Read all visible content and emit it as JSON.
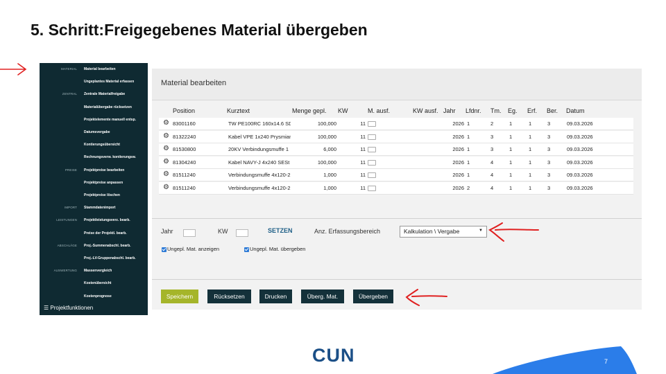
{
  "slide": {
    "title": "5. Schritt:Freigegebenes Material übergeben",
    "page_number": "7",
    "logo_text": "CUN"
  },
  "sidebar": {
    "rows": [
      {
        "category": "MATERIAL",
        "item": "Material bearbeiten"
      },
      {
        "category": "",
        "item": "Ungeplantes Material erfassen"
      },
      {
        "category": "ZENTRAL",
        "item": "Zentrale Materialfreigabe"
      },
      {
        "category": "",
        "item": "Materialübergabe rücksetzen"
      },
      {
        "category": "",
        "item": "Projektelemente manuell entsp."
      },
      {
        "category": "",
        "item": "Datumsvergabe"
      },
      {
        "category": "",
        "item": "Kontierungsübersicht"
      },
      {
        "category": "",
        "item": "Rechnungsverw. kontierungsw."
      },
      {
        "category": "PREISE",
        "item": "Projektpreise bearbeiten"
      },
      {
        "category": "",
        "item": "Projektpreise anpassen"
      },
      {
        "category": "",
        "item": "Projektpreise löschen"
      },
      {
        "category": "IMPORT",
        "item": "Stammdatenimport"
      },
      {
        "category": "LEISTUNGEN",
        "item": "Projektleistungsverz. bearb."
      },
      {
        "category": "",
        "item": "Preise der Projektl. bearb."
      },
      {
        "category": "ABSCHLÄGE",
        "item": "Proj.-Summenabschl. bearb."
      },
      {
        "category": "",
        "item": "Proj.-LV-Gruppenabschl. bearb."
      },
      {
        "category": "AUSWERTUNG",
        "item": "Massenvergleich"
      },
      {
        "category": "",
        "item": "Kostenübersicht"
      },
      {
        "category": "",
        "item": "Kostenprognose"
      }
    ],
    "footer_icon": "menu-icon",
    "footer_label": "Projektfunktionen"
  },
  "main": {
    "title": "Material bearbeiten",
    "columns": [
      "Position",
      "Kurztext",
      "Menge gepl.",
      "KW",
      "M. ausf.",
      "KW ausf.",
      "Jahr",
      "Lfdnr.",
      "Tm.",
      "Eg.",
      "Erf.",
      "Ber.",
      "Datum"
    ],
    "rows": [
      {
        "position": "83001160",
        "kurztext": "TW PE100RC 160x14.6 SD",
        "menge": "100,000",
        "kw": "11",
        "jahr": "2026",
        "lfdnr": "1",
        "tm": "2",
        "eg": "1",
        "erf": "1",
        "ber": "3",
        "datum": "09.03.2026"
      },
      {
        "position": "81322240",
        "kurztext": "Kabel VPE 1x240 Prysmian",
        "menge": "100,000",
        "kw": "11",
        "jahr": "2026",
        "lfdnr": "1",
        "tm": "3",
        "eg": "1",
        "erf": "1",
        "ber": "3",
        "datum": "09.03.2026"
      },
      {
        "position": "81530800",
        "kurztext": "20KV Verbindungsmuffe 1",
        "menge": "6,000",
        "kw": "11",
        "jahr": "2026",
        "lfdnr": "1",
        "tm": "3",
        "eg": "1",
        "erf": "1",
        "ber": "3",
        "datum": "09.03.2026"
      },
      {
        "position": "81304240",
        "kurztext": "Kabel NAVY-J 4x240 SESt",
        "menge": "100,000",
        "kw": "11",
        "jahr": "2026",
        "lfdnr": "1",
        "tm": "4",
        "eg": "1",
        "erf": "1",
        "ber": "3",
        "datum": "09.03.2026"
      },
      {
        "position": "81511240",
        "kurztext": "Verbindungsmuffe 4x120-2",
        "menge": "1,000",
        "kw": "11",
        "jahr": "2026",
        "lfdnr": "1",
        "tm": "4",
        "eg": "1",
        "erf": "1",
        "ber": "3",
        "datum": "09.03.2026"
      },
      {
        "position": "81511240",
        "kurztext": "Verbindungsmuffe 4x120-2",
        "menge": "1,000",
        "kw": "11",
        "jahr": "2026",
        "lfdnr": "2",
        "tm": "4",
        "eg": "1",
        "erf": "1",
        "ber": "3",
        "datum": "09.03.2026"
      }
    ]
  },
  "filters": {
    "jahr_label": "Jahr",
    "kw_label": "KW",
    "setzen_label": "SETZEN",
    "bereich_label": "Anz. Erfassungsbereich",
    "bereich_value": "Kalkulation \\ Vergabe",
    "check1_label": "Ungepl. Mat. anzeigen",
    "check2_label": "Ungepl. Mat. übergeben"
  },
  "buttons": {
    "speichern": "Speichern",
    "ruecksetzen": "Rücksetzen",
    "drucken": "Drucken",
    "ueberg_mat": "Überg. Mat.",
    "uebergeben": "Übergeben"
  },
  "colors": {
    "sidebar_bg": "#0f2a32",
    "primary_button": "#a5b52a",
    "dark_button": "#14313a",
    "annotation_red": "#e02020",
    "accent_blue": "#2b7de9"
  }
}
